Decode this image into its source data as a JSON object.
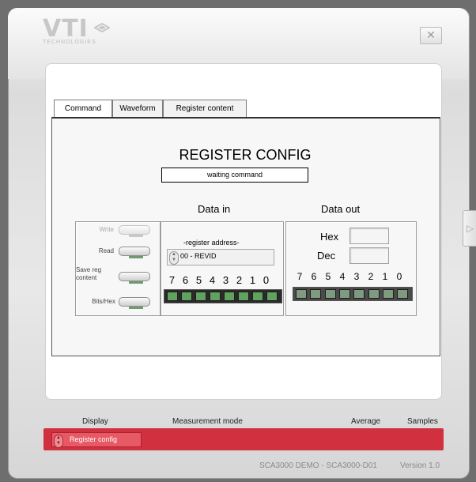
{
  "window": {
    "logo_text": "VTI",
    "logo_subtitle": "TECHNOLOGIES",
    "close_symbol": "✕",
    "side_arrow_symbol": "▷"
  },
  "tabs": [
    {
      "label": "Command",
      "active": true
    },
    {
      "label": "Waveform",
      "active": false
    },
    {
      "label": "Register content",
      "active": false
    }
  ],
  "register": {
    "title": "REGISTER CONFIG",
    "status": "waiting command",
    "data_in_label": "Data in",
    "data_out_label": "Data out",
    "switches": [
      {
        "label": "Write",
        "enabled": false
      },
      {
        "label": "Read",
        "enabled": true
      },
      {
        "label": "Save reg\ncontent",
        "enabled": true
      },
      {
        "label": "Bits/Hex",
        "enabled": true
      }
    ],
    "address_label": "-register address-",
    "address_value": "00 - REVID",
    "bit_numbers": [
      "7",
      "6",
      "5",
      "4",
      "3",
      "2",
      "1",
      "0"
    ],
    "data_in_bits": [
      1,
      1,
      1,
      1,
      1,
      1,
      1,
      1
    ],
    "data_out_bits": [
      0,
      0,
      0,
      0,
      0,
      0,
      0,
      0
    ],
    "hex_label": "Hex",
    "dec_label": "Dec",
    "hex_value": "",
    "dec_value": ""
  },
  "bottom": {
    "headers": {
      "display": "Display",
      "mode": "Measurement mode",
      "average": "Average",
      "samples": "Samples"
    },
    "display_value": "Register config"
  },
  "footer": {
    "app": "SCA3000 DEMO - SCA3000-D01",
    "version": "Version 1.0"
  },
  "colors": {
    "bar_red": "#d1303f",
    "led_on": "#5fa35f",
    "led_off": "#7f9a7f"
  }
}
